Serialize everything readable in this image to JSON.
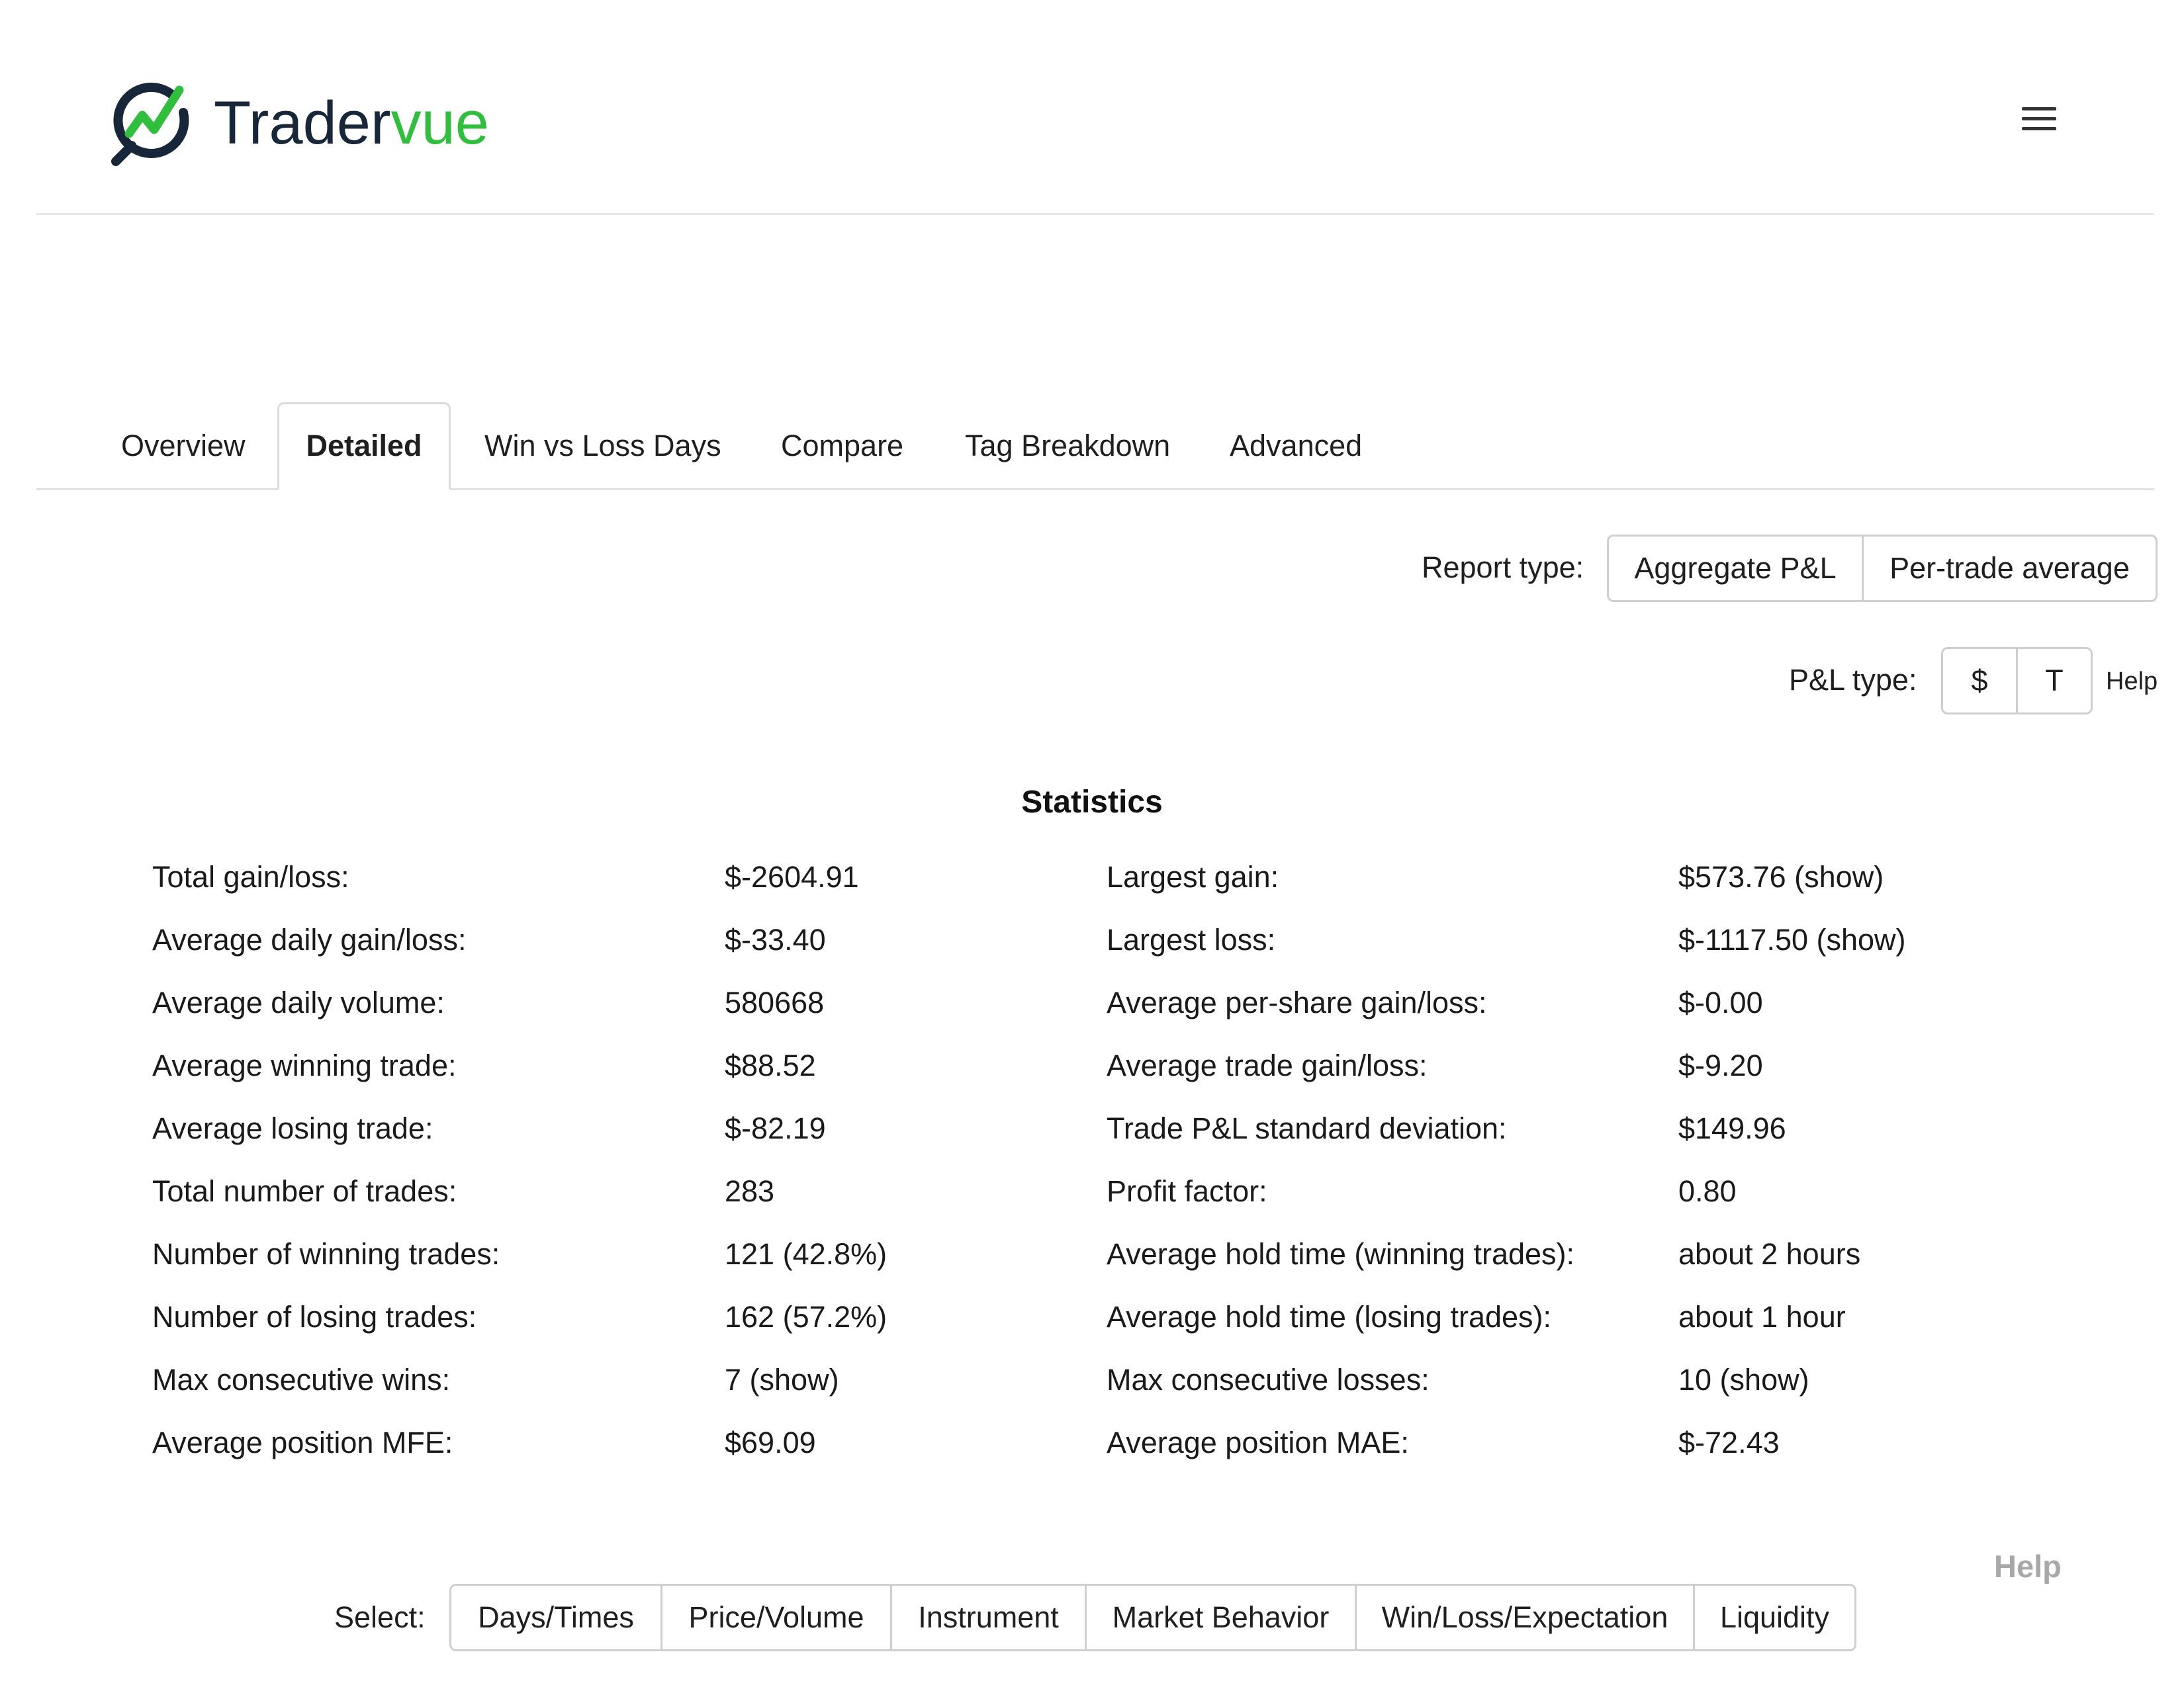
{
  "header": {
    "logo_part1": "Trader",
    "logo_part2": "vue"
  },
  "tabs": [
    {
      "label": "Overview",
      "active": false
    },
    {
      "label": "Detailed",
      "active": true
    },
    {
      "label": "Win vs Loss Days",
      "active": false
    },
    {
      "label": "Compare",
      "active": false
    },
    {
      "label": "Tag Breakdown",
      "active": false
    },
    {
      "label": "Advanced",
      "active": false
    }
  ],
  "report_type": {
    "label": "Report type:",
    "options": [
      "Aggregate P&L",
      "Per-trade average"
    ]
  },
  "pl_type": {
    "label": "P&L type:",
    "options": [
      "$",
      "T"
    ],
    "help": "Help"
  },
  "statistics": {
    "title": "Statistics",
    "rows": [
      {
        "label1": "Total gain/loss:",
        "value1": "$-2604.91",
        "label2": "Largest gain:",
        "value2": "$573.76 (show)"
      },
      {
        "label1": "Average daily gain/loss:",
        "value1": "$-33.40",
        "label2": "Largest loss:",
        "value2": "$-1117.50 (show)"
      },
      {
        "label1": "Average daily volume:",
        "value1": "580668",
        "label2": "Average per-share gain/loss:",
        "value2": "$-0.00"
      },
      {
        "label1": "Average winning trade:",
        "value1": "$88.52",
        "label2": "Average trade gain/loss:",
        "value2": "$-9.20"
      },
      {
        "label1": "Average losing trade:",
        "value1": "$-82.19",
        "label2": "Trade P&L standard deviation:",
        "value2": "$149.96"
      },
      {
        "label1": "Total number of trades:",
        "value1": "283",
        "label2": "Profit factor:",
        "value2": "0.80"
      },
      {
        "label1": "Number of winning trades:",
        "value1": "121 (42.8%)",
        "label2": "Average hold time (winning trades):",
        "value2": "about 2 hours"
      },
      {
        "label1": "Number of losing trades:",
        "value1": "162 (57.2%)",
        "label2": "Average hold time (losing trades):",
        "value2": "about 1 hour"
      },
      {
        "label1": "Max consecutive wins:",
        "value1": "7 (show)",
        "label2": "Max consecutive losses:",
        "value2": "10 (show)"
      },
      {
        "label1": "Average position MFE:",
        "value1": "$69.09",
        "label2": "Average position MAE:",
        "value2": "$-72.43"
      }
    ]
  },
  "help_link": "Help",
  "select": {
    "label": "Select:",
    "options": [
      "Days/Times",
      "Price/Volume",
      "Instrument",
      "Market Behavior",
      "Win/Loss/Expectation",
      "Liquidity"
    ]
  },
  "colors": {
    "brand_dark": "#18263a",
    "brand_green": "#2fbf3c",
    "border": "#cfcfcf",
    "help_grey": "#a8a8a8"
  }
}
